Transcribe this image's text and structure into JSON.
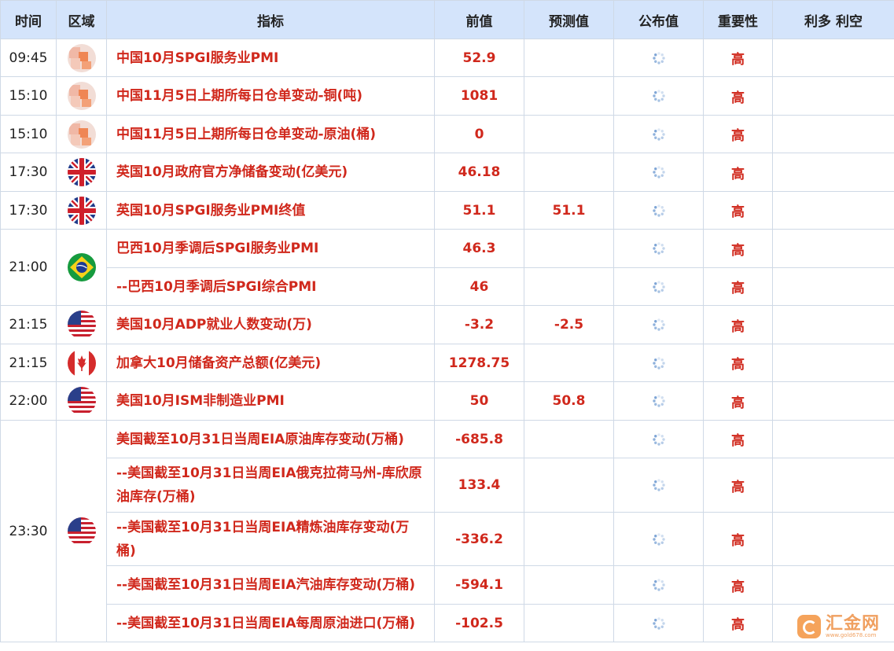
{
  "columns": [
    "时间",
    "区域",
    "指标",
    "前值",
    "预测值",
    "公布值",
    "重要性",
    "利多 利空"
  ],
  "rows": [
    {
      "time": "09:45",
      "region": "CN",
      "indicator": "中国10月SPGI服务业PMI",
      "previous": "52.9",
      "forecast": "",
      "importance": "高"
    },
    {
      "time": "15:10",
      "region": "CN",
      "indicator": "中国11月5日上期所每日仓单变动-铜(吨)",
      "previous": "1081",
      "forecast": "",
      "importance": "高"
    },
    {
      "time": "15:10",
      "region": "CN",
      "indicator": "中国11月5日上期所每日仓单变动-原油(桶)",
      "previous": "0",
      "forecast": "",
      "importance": "高"
    },
    {
      "time": "17:30",
      "region": "UK",
      "indicator": "英国10月政府官方净储备变动(亿美元)",
      "previous": "46.18",
      "forecast": "",
      "importance": "高"
    },
    {
      "time": "17:30",
      "region": "UK",
      "indicator": "英国10月SPGI服务业PMI终值",
      "previous": "51.1",
      "forecast": "51.1",
      "importance": "高"
    },
    {
      "time": "21:00",
      "region": "BR",
      "indicator": "巴西10月季调后SPGI服务业PMI",
      "previous": "46.3",
      "forecast": "",
      "importance": "高"
    },
    {
      "time": "",
      "region": "",
      "indicator": "--巴西10月季调后SPGI综合PMI",
      "previous": "46",
      "forecast": "",
      "importance": "高"
    },
    {
      "time": "21:15",
      "region": "US",
      "indicator": "美国10月ADP就业人数变动(万)",
      "previous": "-3.2",
      "forecast": "-2.5",
      "importance": "高"
    },
    {
      "time": "21:15",
      "region": "CA",
      "indicator": "加拿大10月储备资产总额(亿美元)",
      "previous": "1278.75",
      "forecast": "",
      "importance": "高"
    },
    {
      "time": "22:00",
      "region": "US",
      "indicator": "美国10月ISM非制造业PMI",
      "previous": "50",
      "forecast": "50.8",
      "importance": "高"
    },
    {
      "time": "23:30",
      "region": "US",
      "indicator": "美国截至10月31日当周EIA原油库存变动(万桶)",
      "previous": "-685.8",
      "forecast": "",
      "importance": "高"
    },
    {
      "time": "",
      "region": "",
      "indicator": "--美国截至10月31日当周EIA俄克拉荷马州-库欣原油库存(万桶)",
      "previous": "133.4",
      "forecast": "",
      "importance": "高"
    },
    {
      "time": "",
      "region": "",
      "indicator": "--美国截至10月31日当周EIA精炼油库存变动(万桶)",
      "previous": "-336.2",
      "forecast": "",
      "importance": "高"
    },
    {
      "time": "",
      "region": "",
      "indicator": "--美国截至10月31日当周EIA汽油库存变动(万桶)",
      "previous": "-594.1",
      "forecast": "",
      "importance": "高"
    },
    {
      "time": "",
      "region": "",
      "indicator": "--美国截至10月31日当周EIA每周原油进口(万桶)",
      "previous": "-102.5",
      "forecast": "",
      "importance": "高"
    }
  ],
  "icons": {
    "flag": "country-flag-icon",
    "published": "loading-spinner-icon"
  },
  "colors": {
    "header_bg": "#d4e4fb",
    "accent_red": "#d0281c",
    "border": "#cfd9e6"
  },
  "watermark": {
    "name": "汇金网",
    "url": "www.gold678.com"
  }
}
